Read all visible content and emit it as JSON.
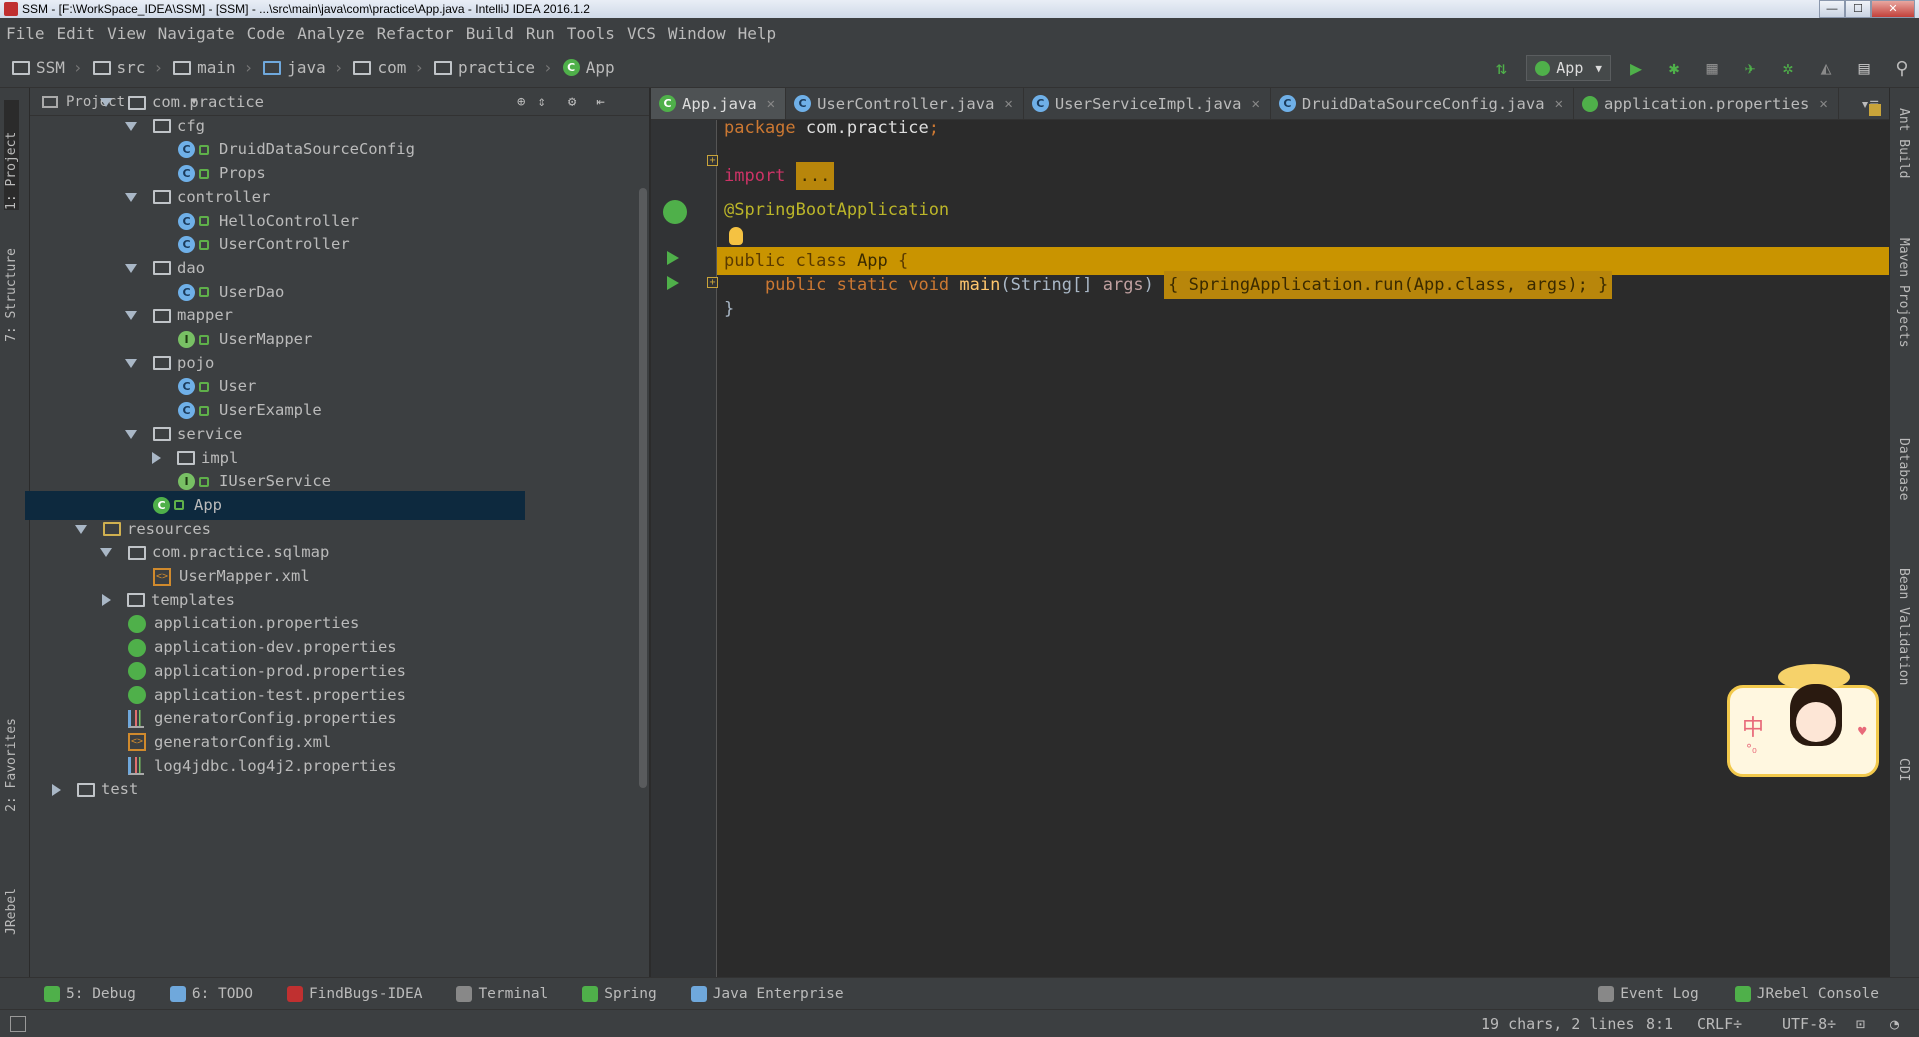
{
  "window": {
    "title": "SSM - [F:\\WorkSpace_IDEA\\SSM] - [SSM] - ...\\src\\main\\java\\com\\practice\\App.java - IntelliJ IDEA 2016.1.2",
    "minimize": "—",
    "maximize": "☐",
    "close": "✕"
  },
  "menu": [
    "File",
    "Edit",
    "View",
    "Navigate",
    "Code",
    "Analyze",
    "Refactor",
    "Build",
    "Run",
    "Tools",
    "VCS",
    "Window",
    "Help"
  ],
  "breadcrumbs": [
    "SSM",
    "src",
    "main",
    "java",
    "com",
    "practice",
    "App"
  ],
  "run_config": {
    "label": "App",
    "caret": "▼"
  },
  "toolbar_icons": [
    "sort-icon",
    "run-icon",
    "debug-icon",
    "coverage-icon",
    "jrebel-run-icon",
    "jrebel-debug-icon",
    "stop-icon",
    "structure-icon",
    "search-icon"
  ],
  "left_tabs": [
    "1: Project",
    "7: Structure",
    "2: Favorites",
    "JRebel"
  ],
  "right_tabs": [
    "Ant Build",
    "Maven Projects",
    "Database",
    "Bean Validation",
    "CDI"
  ],
  "project_panel": {
    "title": "Project",
    "caret": "▼",
    "tree": [
      {
        "label": "com.practice",
        "type": "folder",
        "indent": 4,
        "expanded": true
      },
      {
        "label": "cfg",
        "type": "folder",
        "indent": 5,
        "expanded": true
      },
      {
        "label": "DruidDataSourceConfig",
        "type": "class",
        "indent": 6
      },
      {
        "label": "Props",
        "type": "class",
        "indent": 6
      },
      {
        "label": "controller",
        "type": "folder",
        "indent": 5,
        "expanded": true
      },
      {
        "label": "HelloController",
        "type": "class",
        "indent": 6
      },
      {
        "label": "UserController",
        "type": "class",
        "indent": 6
      },
      {
        "label": "dao",
        "type": "folder",
        "indent": 5,
        "expanded": true
      },
      {
        "label": "UserDao",
        "type": "class",
        "indent": 6
      },
      {
        "label": "mapper",
        "type": "folder",
        "indent": 5,
        "expanded": true
      },
      {
        "label": "UserMapper",
        "type": "interface",
        "indent": 6
      },
      {
        "label": "pojo",
        "type": "folder",
        "indent": 5,
        "expanded": true
      },
      {
        "label": "User",
        "type": "class",
        "indent": 6
      },
      {
        "label": "UserExample",
        "type": "class",
        "indent": 6
      },
      {
        "label": "service",
        "type": "folder",
        "indent": 5,
        "expanded": true
      },
      {
        "label": "impl",
        "type": "folder",
        "indent": 6,
        "expanded": false
      },
      {
        "label": "IUserService",
        "type": "interface",
        "indent": 6
      },
      {
        "label": "App",
        "type": "app",
        "indent": 5,
        "selected": true
      },
      {
        "label": "resources",
        "type": "resfolder",
        "indent": 3,
        "expanded": true
      },
      {
        "label": "com.practice.sqlmap",
        "type": "folder",
        "indent": 4,
        "expanded": true
      },
      {
        "label": "UserMapper.xml",
        "type": "xml",
        "indent": 5
      },
      {
        "label": "templates",
        "type": "folder",
        "indent": 4,
        "expanded": false
      },
      {
        "label": "application.properties",
        "type": "props",
        "indent": 4
      },
      {
        "label": "application-dev.properties",
        "type": "props",
        "indent": 4
      },
      {
        "label": "application-prod.properties",
        "type": "props",
        "indent": 4
      },
      {
        "label": "application-test.properties",
        "type": "props",
        "indent": 4
      },
      {
        "label": "generatorConfig.properties",
        "type": "bars",
        "indent": 4
      },
      {
        "label": "generatorConfig.xml",
        "type": "xml",
        "indent": 4
      },
      {
        "label": "log4jdbc.log4j2.properties",
        "type": "bars",
        "indent": 4
      },
      {
        "label": "test",
        "type": "folder",
        "indent": 2,
        "expanded": false
      }
    ]
  },
  "editor_tabs": [
    {
      "label": "App.java",
      "icon": "app",
      "active": true
    },
    {
      "label": "UserController.java",
      "icon": "class"
    },
    {
      "label": "UserServiceImpl.java",
      "icon": "class"
    },
    {
      "label": "DruidDataSourceConfig.java",
      "icon": "class"
    },
    {
      "label": "application.properties",
      "icon": "props"
    }
  ],
  "editor_tabs_overflow": "▾≡",
  "code": {
    "l1_kw": "package",
    "l1_pkg": " com.practice",
    "l1_semi": ";",
    "l2_kw": "import",
    "l2_fold": "...",
    "l3_ann": "@SpringBootApplication",
    "l4_kw": "public class",
    "l4_name": " App ",
    "l4_brace": "{",
    "l5_kw": "    public static void",
    "l5_fn": " main",
    "l5_sig": "(String[] ",
    "l5_param": "args",
    "l5_close": ") ",
    "l5_body_open": "{ ",
    "l5_body": "SpringApplication.run(App.class, args);",
    "l5_body_close": " }",
    "l6_brace": "}"
  },
  "bottom_tools": [
    {
      "label": "5: Debug",
      "color": "#4fb04a"
    },
    {
      "label": "6: TODO",
      "color": "#6fa8dc"
    },
    {
      "label": "FindBugs-IDEA",
      "color": "#c03030"
    },
    {
      "label": "Terminal",
      "color": "#888888"
    },
    {
      "label": "Spring",
      "color": "#4fb04a"
    },
    {
      "label": "Java Enterprise",
      "color": "#6fa8dc"
    }
  ],
  "bottom_right_tools": [
    "Event Log",
    "JRebel Console"
  ],
  "status": {
    "chars": "19 chars, 2 lines",
    "position": "8:1",
    "line_sep": "CRLF÷",
    "encoding": "UTF-8÷"
  },
  "sticker": {
    "char": "中",
    "sub": "°₀"
  }
}
